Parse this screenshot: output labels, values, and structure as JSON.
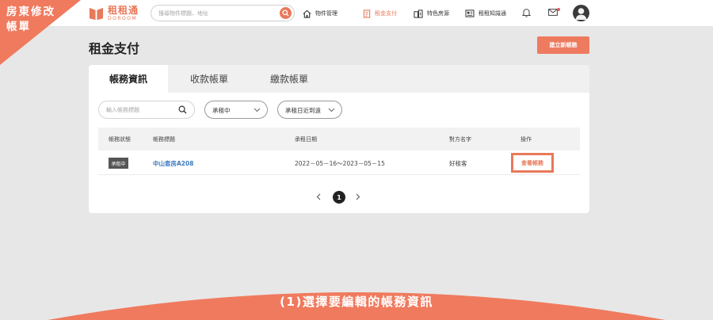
{
  "corner_badge": {
    "text": "房東修改\n帳單"
  },
  "header": {
    "logo_name": "租租通",
    "logo_sub": "DOROOM",
    "search_placeholder": "搜尋物件標題、地址",
    "nav": [
      {
        "label": "物件管理",
        "icon": "house-icon",
        "active": false
      },
      {
        "label": "租金支付",
        "icon": "bill-icon",
        "active": true
      },
      {
        "label": "特色房源",
        "icon": "buildings-icon",
        "active": false
      },
      {
        "label": "租租知識通",
        "icon": "newspaper-icon",
        "active": false
      }
    ]
  },
  "page": {
    "title": "租金支付",
    "create_label": "建立新帳務"
  },
  "tabs": [
    {
      "label": "帳務資訊",
      "active": true
    },
    {
      "label": "收款帳單",
      "active": false
    },
    {
      "label": "繳款帳單",
      "active": false
    }
  ],
  "filters": {
    "search_placeholder": "輸入帳務標題",
    "status_value": "承租中",
    "sort_value": "承租日近到遠"
  },
  "table": {
    "headers": [
      "帳務狀態",
      "帳務標題",
      "承租日期",
      "對方名字",
      "操作"
    ],
    "rows": [
      {
        "status": "承租中",
        "title": "中山套房A208",
        "period": "2022－05－16～2023－05－15",
        "name": "好租客",
        "action": "查看帳務"
      }
    ]
  },
  "pagination": {
    "current": "1"
  },
  "banner": {
    "text": "(1)選擇要編輯的帳務資訊"
  },
  "colors": {
    "accent": "#ee7b5f",
    "link": "#3d7bbf"
  }
}
